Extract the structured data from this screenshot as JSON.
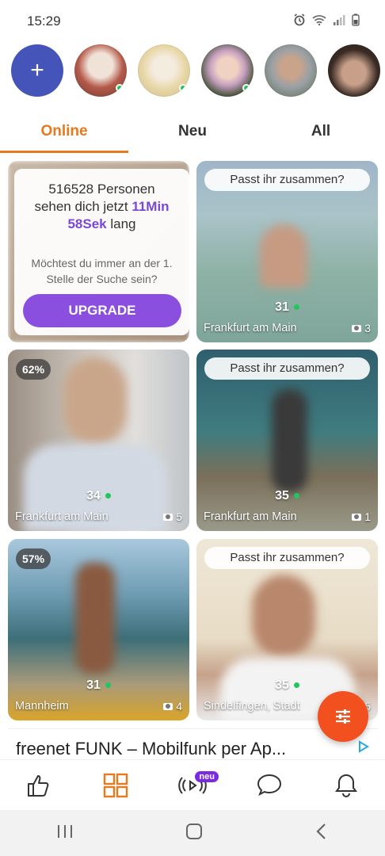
{
  "status_bar": {
    "time": "15:29"
  },
  "stories": {
    "add_label": "+",
    "items": [
      {
        "online": true,
        "color_a": "#b45a4a",
        "color_b": "#f1e2d8"
      },
      {
        "online": true,
        "color_a": "#e8d7a6",
        "color_b": "#efe6d6"
      },
      {
        "online": true,
        "color_a": "#3b4d2f",
        "color_b": "#c7a0c0"
      },
      {
        "online": false,
        "color_a": "#9aa0a5",
        "color_b": "#5a6c4a"
      },
      {
        "online": false,
        "color_a": "#3a2b24",
        "color_b": "#c8a08a"
      }
    ]
  },
  "tabs": [
    {
      "label": "Online",
      "active": true
    },
    {
      "label": "Neu",
      "active": false
    },
    {
      "label": "All",
      "active": false
    }
  ],
  "upgrade": {
    "count": "516528",
    "text_a": "Personen",
    "text_b": "sehen dich jetzt",
    "time_highlight_1": "11Min",
    "time_highlight_2": "58Sek",
    "text_c": "lang",
    "question": "Möchtest du immer an der 1. Stelle der Suche sein?",
    "button": "UPGRADE"
  },
  "cards": [
    {
      "id": "c2",
      "match_pill": "Passt ihr zusammen?",
      "age": "31",
      "city": "Frankfurt am Main",
      "photos": "3"
    },
    {
      "id": "c3",
      "pct": "62%",
      "age": "34",
      "city": "Frankfurt am Main",
      "photos": "5"
    },
    {
      "id": "c4",
      "match_pill": "Passt ihr zusammen?",
      "age": "35",
      "city": "Frankfurt am Main",
      "photos": "1"
    },
    {
      "id": "c5",
      "pct": "57%",
      "age": "31",
      "city": "Mannheim",
      "photos": "4"
    },
    {
      "id": "c6",
      "match_pill": "Passt ihr zusammen?",
      "age": "35",
      "city": "Sindelfingen, Stadt",
      "photos": "5"
    }
  ],
  "ad": {
    "text": "freenet FUNK – Mobilfunk per Ap..."
  },
  "bottom_nav": {
    "badge": "neu"
  },
  "colors": {
    "accent": "#e8791f",
    "upgrade": "#8b4fe0",
    "fab": "#f3501f",
    "online": "#22c55e"
  }
}
